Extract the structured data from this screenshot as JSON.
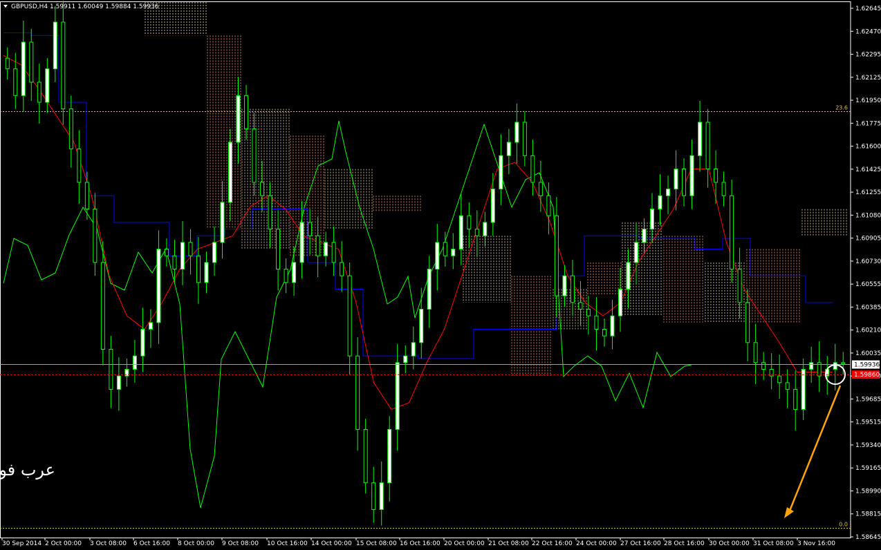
{
  "header": {
    "symbol": "GBPUSD,H4",
    "open": "1.59911",
    "high": "1.60049",
    "low": "1.59884",
    "close": "1.59936"
  },
  "watermark": "عرب فوركس",
  "colors": {
    "background": "#000000",
    "bull_candle": "#ffffff",
    "bear_candle": "#000000",
    "wick": "#00ff00",
    "tenkan": "#ff0000",
    "kijun": "#0000ff",
    "chikou": "#00ff00",
    "cloud_a": "#ffe4b5",
    "cloud_b": "#ffa07a",
    "fib": "#e0c060",
    "arrow": "#ffa500",
    "bid_line": "#a0a0a0",
    "ask_line": "#ff0000"
  },
  "chart_data": {
    "type": "candlestick",
    "symbol": "GBPUSD",
    "timeframe": "H4",
    "indicator": "Ichimoku",
    "y_axis_labels": [
      "1.62645",
      "1.62470",
      "1.62295",
      "1.62125",
      "1.61950",
      "1.61775",
      "1.61600",
      "1.61425",
      "1.61255",
      "1.61080",
      "1.60905",
      "1.60730",
      "1.60555",
      "1.60385",
      "1.60210",
      "1.60035",
      "1.59860",
      "1.59685",
      "1.59515",
      "1.59340",
      "1.59165",
      "1.58990",
      "1.58815",
      "1.58645"
    ],
    "ylim": [
      1.5864,
      1.6265
    ],
    "x_axis_labels": [
      "30 Sep 2014",
      "2 Oct 00:00",
      "3 Oct 08:00",
      "6 Oct 16:00",
      "8 Oct 00:00",
      "9 Oct 08:00",
      "10 Oct 16:00",
      "14 Oct 00:00",
      "15 Oct 08:00",
      "16 Oct 16:00",
      "20 Oct 00:00",
      "21 Oct 08:00",
      "22 Oct 16:00",
      "24 Oct 00:00",
      "27 Oct 16:00",
      "28 Oct 16:00",
      "30 Oct 00:00",
      "31 Oct 08:00",
      "3 Nov 16:00"
    ],
    "current_bid": "1.59936",
    "current_ask": "1.59860",
    "fib_levels": [
      {
        "label": "23.6",
        "price": 1.6183
      },
      {
        "label": "0.0",
        "price": 1.5871
      }
    ],
    "closes": [
      1.6215,
      1.6195,
      1.6235,
      1.6205,
      1.619,
      1.6215,
      1.625,
      1.6185,
      1.6155,
      1.613,
      1.611,
      1.607,
      1.6005,
      1.5975,
      1.5985,
      1.599,
      1.6,
      1.602,
      1.6025,
      1.608,
      1.6075,
      1.6065,
      1.6085,
      1.6075,
      1.6055,
      1.607,
      1.6085,
      1.6115,
      1.616,
      1.6195,
      1.617,
      1.613,
      1.612,
      1.6095,
      1.6065,
      1.6055,
      1.607,
      1.61,
      1.609,
      1.6075,
      1.6085,
      1.607,
      1.606,
      1.6,
      1.5945,
      1.5905,
      1.5885,
      1.5905,
      1.5945,
      1.5995,
      1.6,
      1.601,
      1.6035,
      1.6065,
      1.6085,
      1.6075,
      1.608,
      1.6105,
      1.6095,
      1.609,
      1.61,
      1.6125,
      1.615,
      1.616,
      1.6175,
      1.615,
      1.613,
      1.612,
      1.6105,
      1.6045,
      1.606,
      1.604,
      1.6035,
      1.603,
      1.602,
      1.6015,
      1.603,
      1.605,
      1.607,
      1.6085,
      1.6095,
      1.611,
      1.612,
      1.6125,
      1.614,
      1.612,
      1.615,
      1.6175,
      1.614,
      1.613,
      1.612,
      1.6065,
      1.604,
      1.601,
      1.5995,
      1.599,
      1.5985,
      1.598,
      1.5975,
      1.596,
      1.599,
      1.5995,
      1.5985,
      1.599,
      1.5995,
      1.5994
    ],
    "tenkan_sen": [
      1.6225,
      1.6218,
      1.62,
      1.618,
      1.616,
      1.612,
      1.606,
      1.603,
      1.602,
      1.604,
      1.6065,
      1.608,
      1.6085,
      1.609,
      1.6112,
      1.612,
      1.611,
      1.609,
      1.6085,
      1.608,
      1.604,
      1.598,
      1.596,
      1.5965,
      1.5995,
      1.602,
      1.606,
      1.61,
      1.614,
      1.6145,
      1.613,
      1.61,
      1.606,
      1.604,
      1.603,
      1.604,
      1.607,
      1.609,
      1.611,
      1.614,
      1.614,
      1.6085,
      1.605,
      1.603,
      1.601,
      1.5988,
      1.5988,
      1.5988
    ],
    "kijun_sen": [
      1.6242,
      1.624,
      1.619,
      1.612,
      1.61,
      1.61,
      1.6075,
      1.609,
      1.6095,
      1.611,
      1.611,
      1.607,
      1.605,
      1.6,
      1.6,
      1.5998,
      1.5998,
      1.602,
      1.602,
      1.602,
      1.606,
      1.609,
      1.609,
      1.6088,
      1.6088,
      1.608,
      1.6088,
      1.606,
      1.606,
      1.604,
      1.604
    ]
  }
}
